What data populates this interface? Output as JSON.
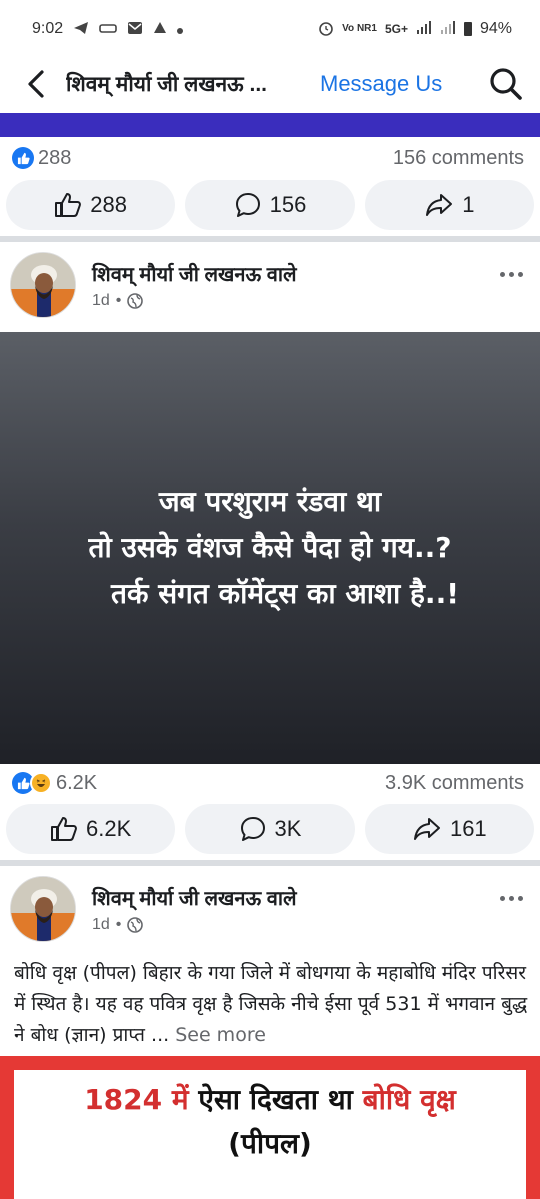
{
  "status_bar": {
    "time": "9:02",
    "network": "5G+",
    "volte": "Vo NR1",
    "battery": "94%"
  },
  "header": {
    "title": "शिवम् मौर्या जी लखनऊ ...",
    "message_us": "Message Us"
  },
  "post1": {
    "reaction_count": "288",
    "comments_summary": "156 comments",
    "like_label": "288",
    "comment_label": "156",
    "share_label": "1"
  },
  "post2": {
    "author": "शिवम् मौर्या जी लखनऊ वाले",
    "time": "1d",
    "dot": "•",
    "card_lines": [
      "जब परशुराम रंडवा था",
      "तो उसके वंशज कैसे पैदा हो गय..?",
      "तर्क संगत कॉमेंट्स का आशा है..!"
    ],
    "reaction_count": "6.2K",
    "comments_summary": "3.9K comments",
    "like_label": "6.2K",
    "comment_label": "3K",
    "share_label": "161"
  },
  "post3": {
    "author": "शिवम् मौर्या जी लखनऊ वाले",
    "time": "1d",
    "dot": "•",
    "text": "बोधि वृक्ष (पीपल) बिहार के गया जिले में बोधगया के महाबोधि मंदिर परिसर में स्थित है। यह वह पवित्र वृक्ष है जिसके नीचे ईसा पूर्व 531 में भगवान बुद्ध ने बोध (ज्ञान) प्राप्त ... ",
    "see_more": "See more",
    "image_headline_red1": "1824 में ",
    "image_headline_black": "ऐसा दिखता था ",
    "image_headline_red2": "बोधि वृक्ष",
    "image_headline_line2": "(पीपल)"
  },
  "colors": {
    "brand_blue": "#1b74e4",
    "like_blue": "#1877f2",
    "strip": "#3a2dbd",
    "pill_bg": "#f0f2f5",
    "headline_red": "#d32f2f"
  },
  "icons": [
    "telegram-icon",
    "mail-icon",
    "alert-icon",
    "alarm-icon",
    "signal-icon",
    "battery-icon",
    "back-arrow-icon",
    "search-icon",
    "like-icon",
    "comment-icon",
    "share-icon",
    "globe-icon",
    "more-icon"
  ]
}
